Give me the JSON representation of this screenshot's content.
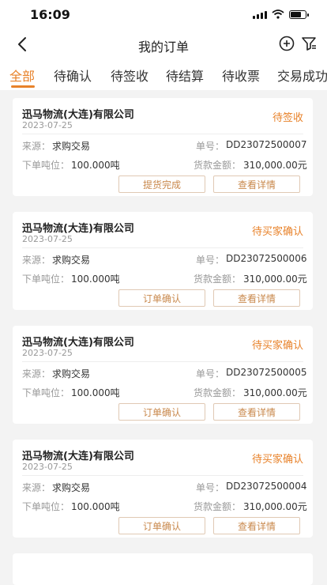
{
  "status_bar": {
    "time": "16:09"
  },
  "nav": {
    "title": "我的订单"
  },
  "tabs": [
    {
      "label": "全部",
      "active": true
    },
    {
      "label": "待确认",
      "active": false
    },
    {
      "label": "待签收",
      "active": false
    },
    {
      "label": "待结算",
      "active": false
    },
    {
      "label": "待收票",
      "active": false
    },
    {
      "label": "交易成功",
      "active": false
    }
  ],
  "labels": {
    "source": "来源：",
    "order_no": "单号：",
    "tonnage": "下单吨位：",
    "amount": "货款金额："
  },
  "orders": [
    {
      "company": "迅马物流(大连)有限公司",
      "date": "2023-07-25",
      "status": "待签收",
      "source": "求购交易",
      "order_no": "DD23072500007",
      "tonnage": "100.000吨",
      "amount": "310,000.00元",
      "btn_left": "提货完成",
      "btn_right": "查看详情"
    },
    {
      "company": "迅马物流(大连)有限公司",
      "date": "2023-07-25",
      "status": "待买家确认",
      "source": "求购交易",
      "order_no": "DD23072500006",
      "tonnage": "100.000吨",
      "amount": "310,000.00元",
      "btn_left": "订单确认",
      "btn_right": "查看详情"
    },
    {
      "company": "迅马物流(大连)有限公司",
      "date": "2023-07-25",
      "status": "待买家确认",
      "source": "求购交易",
      "order_no": "DD23072500005",
      "tonnage": "100.000吨",
      "amount": "310,000.00元",
      "btn_left": "订单确认",
      "btn_right": "查看详情"
    },
    {
      "company": "迅马物流(大连)有限公司",
      "date": "2023-07-25",
      "status": "待买家确认",
      "source": "求购交易",
      "order_no": "DD23072500004",
      "tonnage": "100.000吨",
      "amount": "310,000.00元",
      "btn_left": "订单确认",
      "btn_right": "查看详情"
    }
  ],
  "colors": {
    "accent": "#e8822a",
    "background": "#f3f3f3"
  },
  "icons": {
    "back": "chevron-left-icon",
    "add": "plus-circle-icon",
    "filter": "filter-icon"
  }
}
